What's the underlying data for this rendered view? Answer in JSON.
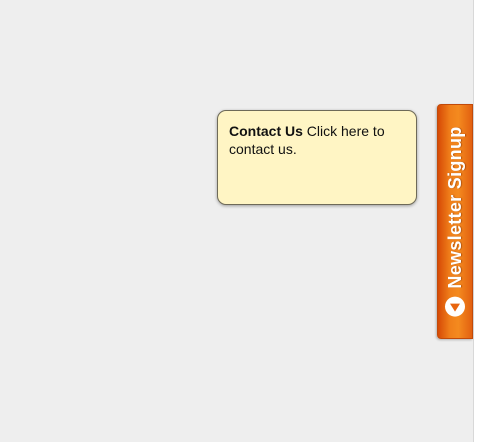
{
  "tooltip": {
    "title": "Contact Us",
    "text": " Click here to contact us."
  },
  "newsletter_tab": {
    "label": "Newsletter Signup",
    "icon": "arrow-left-circle-icon"
  },
  "colors": {
    "background": "#eeeeee",
    "tooltip_background": "#fff5c4",
    "tab_orange": "#f07f1a"
  }
}
